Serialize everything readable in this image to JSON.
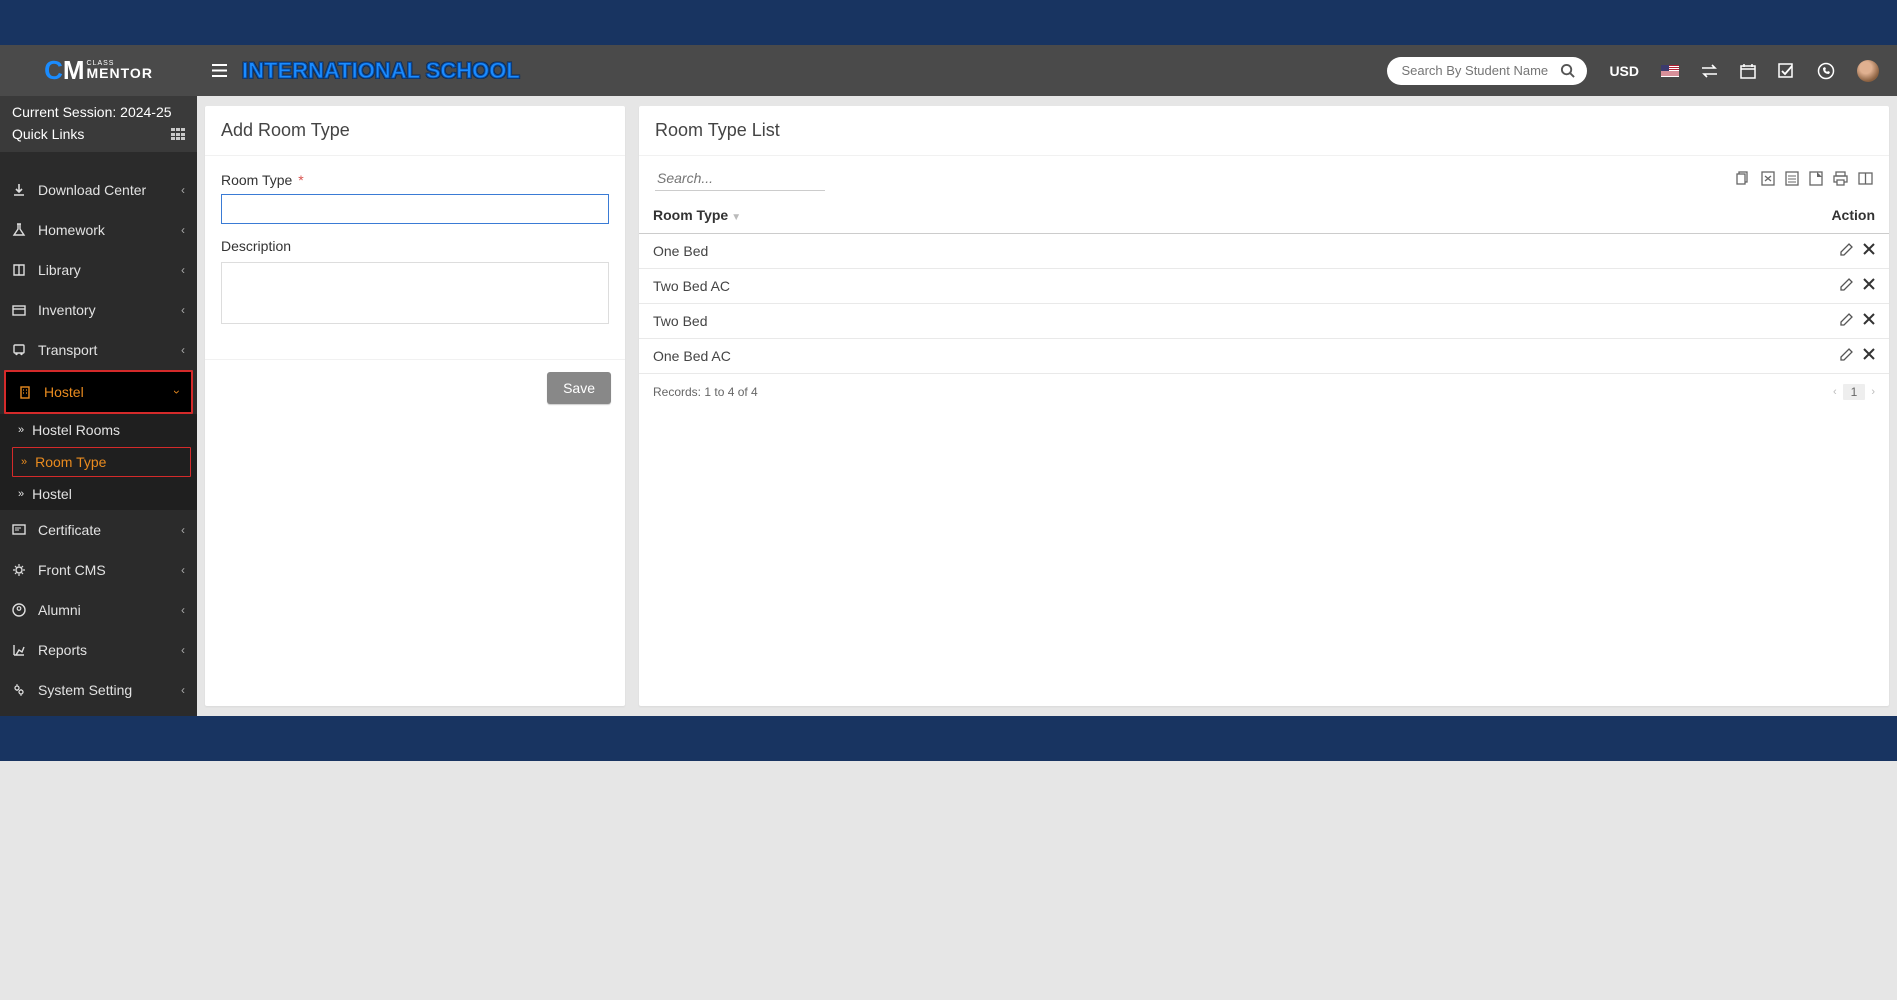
{
  "header": {
    "school_name": "INTERNATIONAL SCHOOL",
    "search_placeholder": "Search By Student Name",
    "currency": "USD"
  },
  "sidebar": {
    "session_label": "Current Session: 2024-25",
    "quick_links": "Quick Links",
    "items": [
      {
        "icon": "download",
        "label": "Download Center"
      },
      {
        "icon": "flask",
        "label": "Homework"
      },
      {
        "icon": "book",
        "label": "Library"
      },
      {
        "icon": "inventory",
        "label": "Inventory"
      },
      {
        "icon": "bus",
        "label": "Transport"
      },
      {
        "icon": "hostel",
        "label": "Hostel",
        "active": true,
        "subs": [
          {
            "label": "Hostel Rooms"
          },
          {
            "label": "Room Type",
            "active": true
          },
          {
            "label": "Hostel"
          }
        ]
      },
      {
        "icon": "certificate",
        "label": "Certificate"
      },
      {
        "icon": "gear",
        "label": "Front CMS"
      },
      {
        "icon": "alumni",
        "label": "Alumni"
      },
      {
        "icon": "reports",
        "label": "Reports"
      },
      {
        "icon": "settings",
        "label": "System Setting"
      }
    ]
  },
  "form": {
    "title": "Add Room Type",
    "room_type_label": "Room Type",
    "description_label": "Description",
    "save_btn": "Save"
  },
  "list": {
    "title": "Room Type List",
    "search_placeholder": "Search...",
    "col_room_type": "Room Type",
    "col_action": "Action",
    "rows": [
      "One Bed",
      "Two Bed AC",
      "Two Bed",
      "One Bed AC"
    ],
    "records_text": "Records: 1 to 4 of 4",
    "page": "1"
  }
}
